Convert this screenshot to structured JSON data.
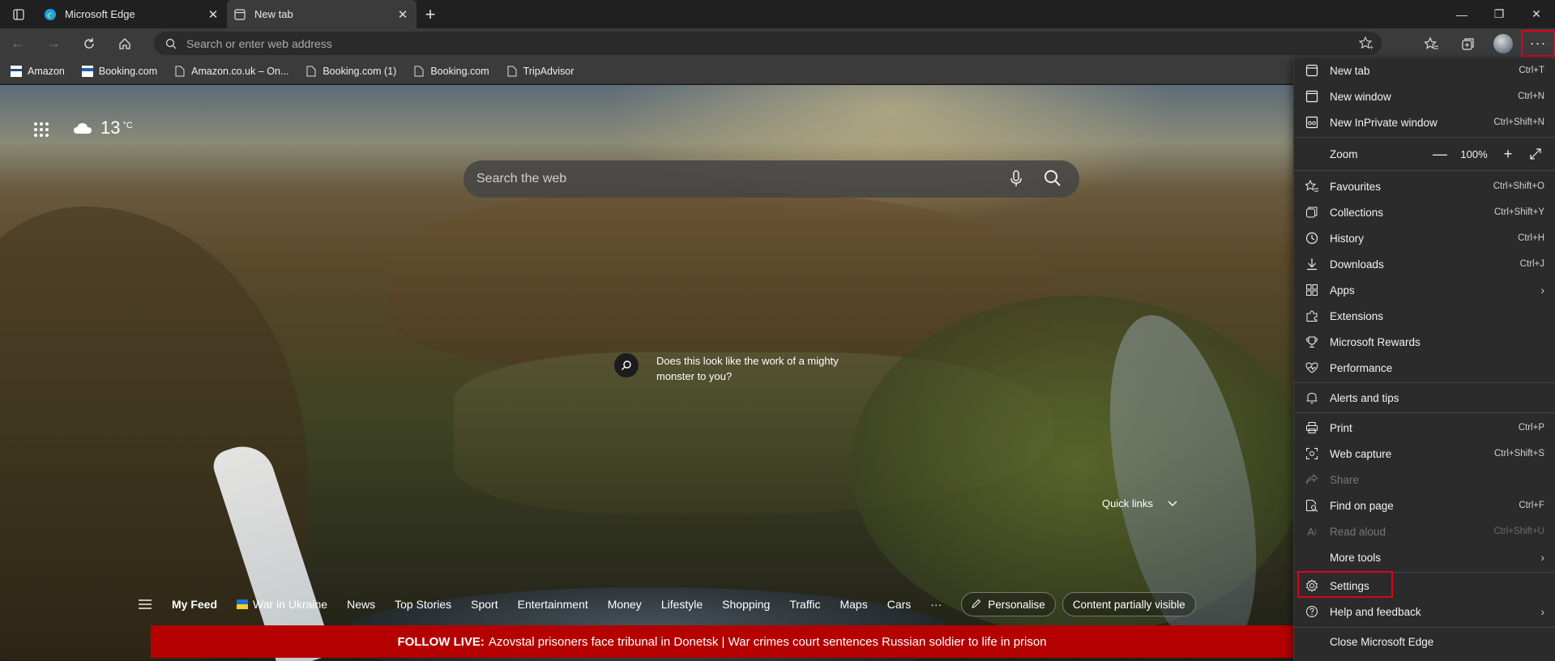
{
  "tabs": [
    {
      "title": "Microsoft Edge",
      "active": false
    },
    {
      "title": "New tab",
      "active": true
    }
  ],
  "address_bar": {
    "placeholder": "Search or enter web address"
  },
  "bookmarks": [
    {
      "label": "Amazon",
      "icon": "amazon-favicon"
    },
    {
      "label": "Booking.com",
      "icon": "booking-favicon"
    },
    {
      "label": "Amazon.co.uk – On...",
      "icon": "page-icon"
    },
    {
      "label": "Booking.com (1)",
      "icon": "page-icon"
    },
    {
      "label": "Booking.com",
      "icon": "page-icon"
    },
    {
      "label": "TripAdvisor",
      "icon": "page-icon"
    }
  ],
  "ntp": {
    "temperature": "13",
    "unit": "°C",
    "search_placeholder": "Search the web",
    "hotspot_text": "Does this look like the work of a mighty monster to you?",
    "quick_links": "Quick links"
  },
  "feed": {
    "items": [
      "My Feed",
      "War in Ukraine",
      "News",
      "Top Stories",
      "Sport",
      "Entertainment",
      "Money",
      "Lifestyle",
      "Shopping",
      "Traffic",
      "Maps",
      "Cars"
    ],
    "more": "···",
    "personalise": "Personalise",
    "visibility": "Content partially visible",
    "follow_live_label": "FOLLOW LIVE:",
    "follow_live_text": "Azovstal prisoners face tribunal in Donetsk | War crimes court sentences Russian soldier to life in prison"
  },
  "menu": {
    "new_tab": {
      "label": "New tab",
      "shortcut": "Ctrl+T"
    },
    "new_window": {
      "label": "New window",
      "shortcut": "Ctrl+N"
    },
    "new_inprivate": {
      "label": "New InPrivate window",
      "shortcut": "Ctrl+Shift+N"
    },
    "zoom": {
      "label": "Zoom",
      "value": "100%",
      "minus": "—",
      "plus": "+"
    },
    "favourites": {
      "label": "Favourites",
      "shortcut": "Ctrl+Shift+O"
    },
    "collections": {
      "label": "Collections",
      "shortcut": "Ctrl+Shift+Y"
    },
    "history": {
      "label": "History",
      "shortcut": "Ctrl+H"
    },
    "downloads": {
      "label": "Downloads",
      "shortcut": "Ctrl+J"
    },
    "apps": {
      "label": "Apps"
    },
    "extensions": {
      "label": "Extensions"
    },
    "rewards": {
      "label": "Microsoft Rewards"
    },
    "performance": {
      "label": "Performance"
    },
    "alerts": {
      "label": "Alerts and tips"
    },
    "print": {
      "label": "Print",
      "shortcut": "Ctrl+P"
    },
    "web_capture": {
      "label": "Web capture",
      "shortcut": "Ctrl+Shift+S"
    },
    "share": {
      "label": "Share"
    },
    "find": {
      "label": "Find on page",
      "shortcut": "Ctrl+F"
    },
    "read_aloud": {
      "label": "Read aloud",
      "shortcut": "Ctrl+Shift+U"
    },
    "more_tools": {
      "label": "More tools"
    },
    "settings": {
      "label": "Settings"
    },
    "help": {
      "label": "Help and feedback"
    },
    "close": {
      "label": "Close Microsoft Edge"
    }
  },
  "colors": {
    "highlight": "#e0001b",
    "follow_live_bg": "#b50000",
    "menu_bg": "#2b2b2b"
  }
}
